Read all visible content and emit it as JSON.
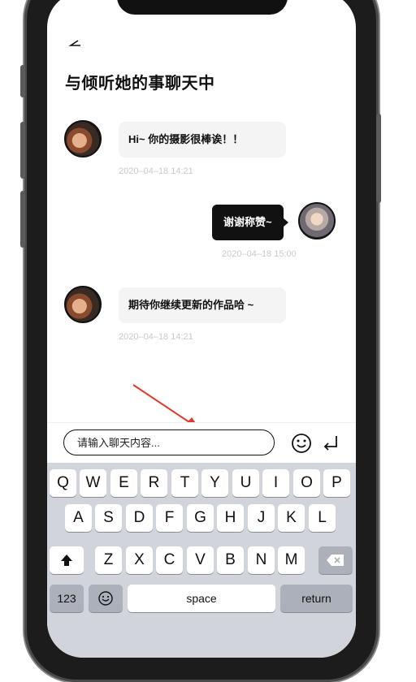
{
  "chat": {
    "title": "与倾听她的事聊天中",
    "messages": [
      {
        "side": "left",
        "text": "Hi~ 你的摄影很棒诶！！",
        "time": "2020–04–18 14:21"
      },
      {
        "side": "right",
        "text": "谢谢称赞~",
        "time": "2020–04–18 15:00"
      },
      {
        "side": "left",
        "text": "期待你继续更新的作品哈 ~",
        "time": "2020–04–18 14:21"
      }
    ]
  },
  "input": {
    "placeholder": "请输入聊天内容..."
  },
  "keyboard": {
    "row1": [
      "Q",
      "W",
      "E",
      "R",
      "T",
      "Y",
      "U",
      "I",
      "O",
      "P"
    ],
    "row2": [
      "A",
      "S",
      "D",
      "F",
      "G",
      "H",
      "J",
      "K",
      "L"
    ],
    "row3": [
      "Z",
      "X",
      "C",
      "V",
      "B",
      "N",
      "M"
    ],
    "numbers_label": "123",
    "space_label": "space",
    "return_label": "return"
  },
  "colors": {
    "accent": "#e03a2f",
    "bubble_in": "#f4f4f4",
    "bubble_out": "#111111",
    "keyboard_bg": "#d1d4da"
  },
  "icons": [
    "back-arrow-icon",
    "emoji-icon",
    "send-icon",
    "shift-icon",
    "backspace-icon",
    "keyboard-emoji-icon",
    "annotation-arrow-icon"
  ]
}
